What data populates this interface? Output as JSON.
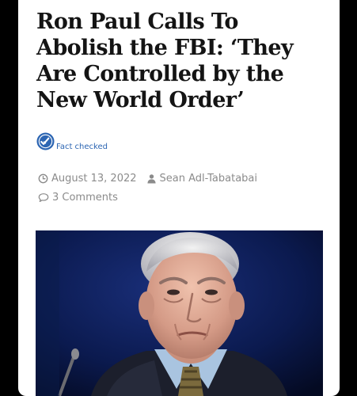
{
  "article": {
    "title": "Ron Paul Calls To Abolish the FBI: ‘They Are Controlled by the New World Order’",
    "fact_check_label": "Fact checked",
    "date": "August 13, 2022",
    "author": "Sean Adl-Tabatabai",
    "comments": "3 Comments"
  },
  "icons": {
    "fact_check": "check-badge-icon",
    "date": "clock-icon",
    "author": "user-icon",
    "comments": "comment-bubble-icon"
  },
  "colors": {
    "accent": "#2d66b3",
    "meta_text": "#8b8b8b",
    "headline": "#141414",
    "frame": "#000000"
  }
}
